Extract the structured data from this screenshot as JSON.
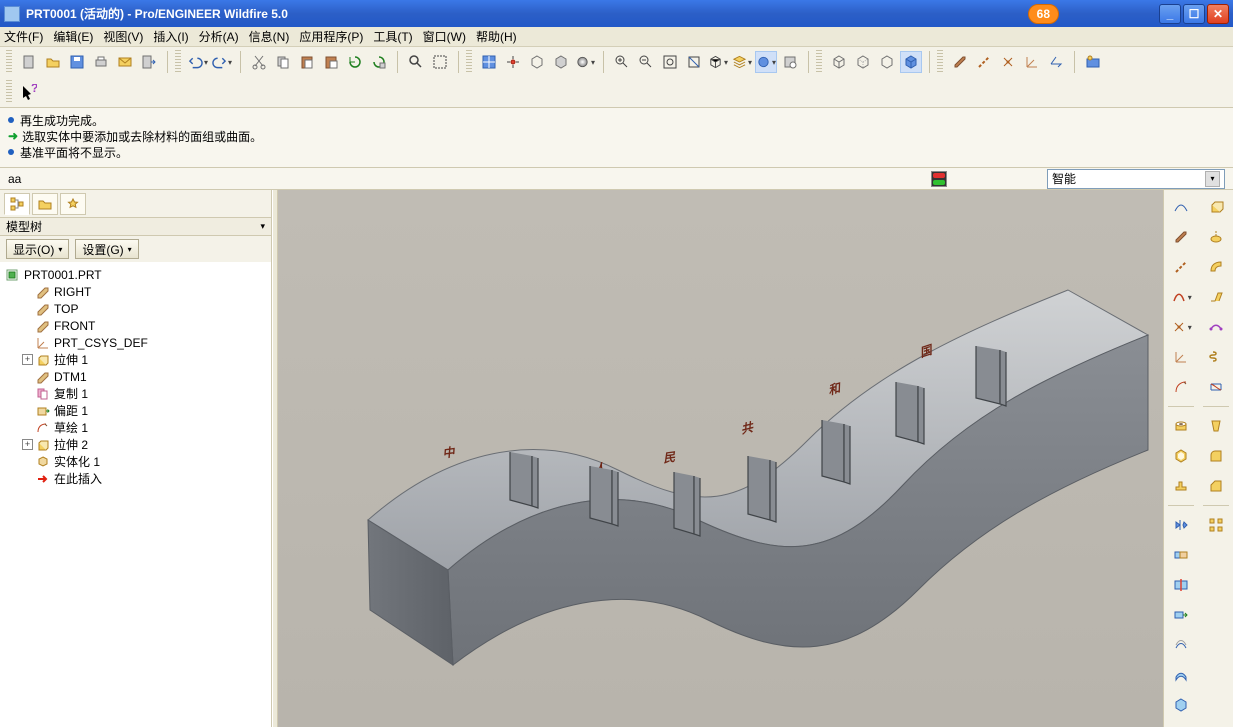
{
  "titlebar": {
    "title": "PRT0001 (活动的) - Pro/ENGINEER Wildfire 5.0",
    "badge": "68"
  },
  "menu": {
    "items": [
      "文件(F)",
      "编辑(E)",
      "视图(V)",
      "插入(I)",
      "分析(A)",
      "信息(N)",
      "应用程序(P)",
      "工具(T)",
      "窗口(W)",
      "帮助(H)"
    ]
  },
  "messages": {
    "m1": "再生成功完成。",
    "m2": "选取实体中要添加或去除材料的面组或曲面。",
    "m3": "基准平面将不显示。"
  },
  "command_prompt": "aa",
  "filter": {
    "selected": "智能"
  },
  "model_tree": {
    "header": "模型树",
    "show_btn": "显示(O)",
    "settings_btn": "设置(G)",
    "root": "PRT0001.PRT",
    "items": [
      {
        "label": "RIGHT",
        "icon": "plane"
      },
      {
        "label": "TOP",
        "icon": "plane"
      },
      {
        "label": "FRONT",
        "icon": "plane"
      },
      {
        "label": "PRT_CSYS_DEF",
        "icon": "csys"
      },
      {
        "label": "拉伸 1",
        "icon": "extrude",
        "exp": "+"
      },
      {
        "label": "DTM1",
        "icon": "plane"
      },
      {
        "label": "复制 1",
        "icon": "copy"
      },
      {
        "label": "偏距 1",
        "icon": "offset"
      },
      {
        "label": "草绘 1",
        "icon": "sketch"
      },
      {
        "label": "拉伸 2",
        "icon": "extrude",
        "exp": "+"
      },
      {
        "label": "实体化 1",
        "icon": "solidify"
      },
      {
        "label": "在此插入",
        "icon": "inserthere"
      }
    ]
  },
  "model_text": "中华人民共和国"
}
